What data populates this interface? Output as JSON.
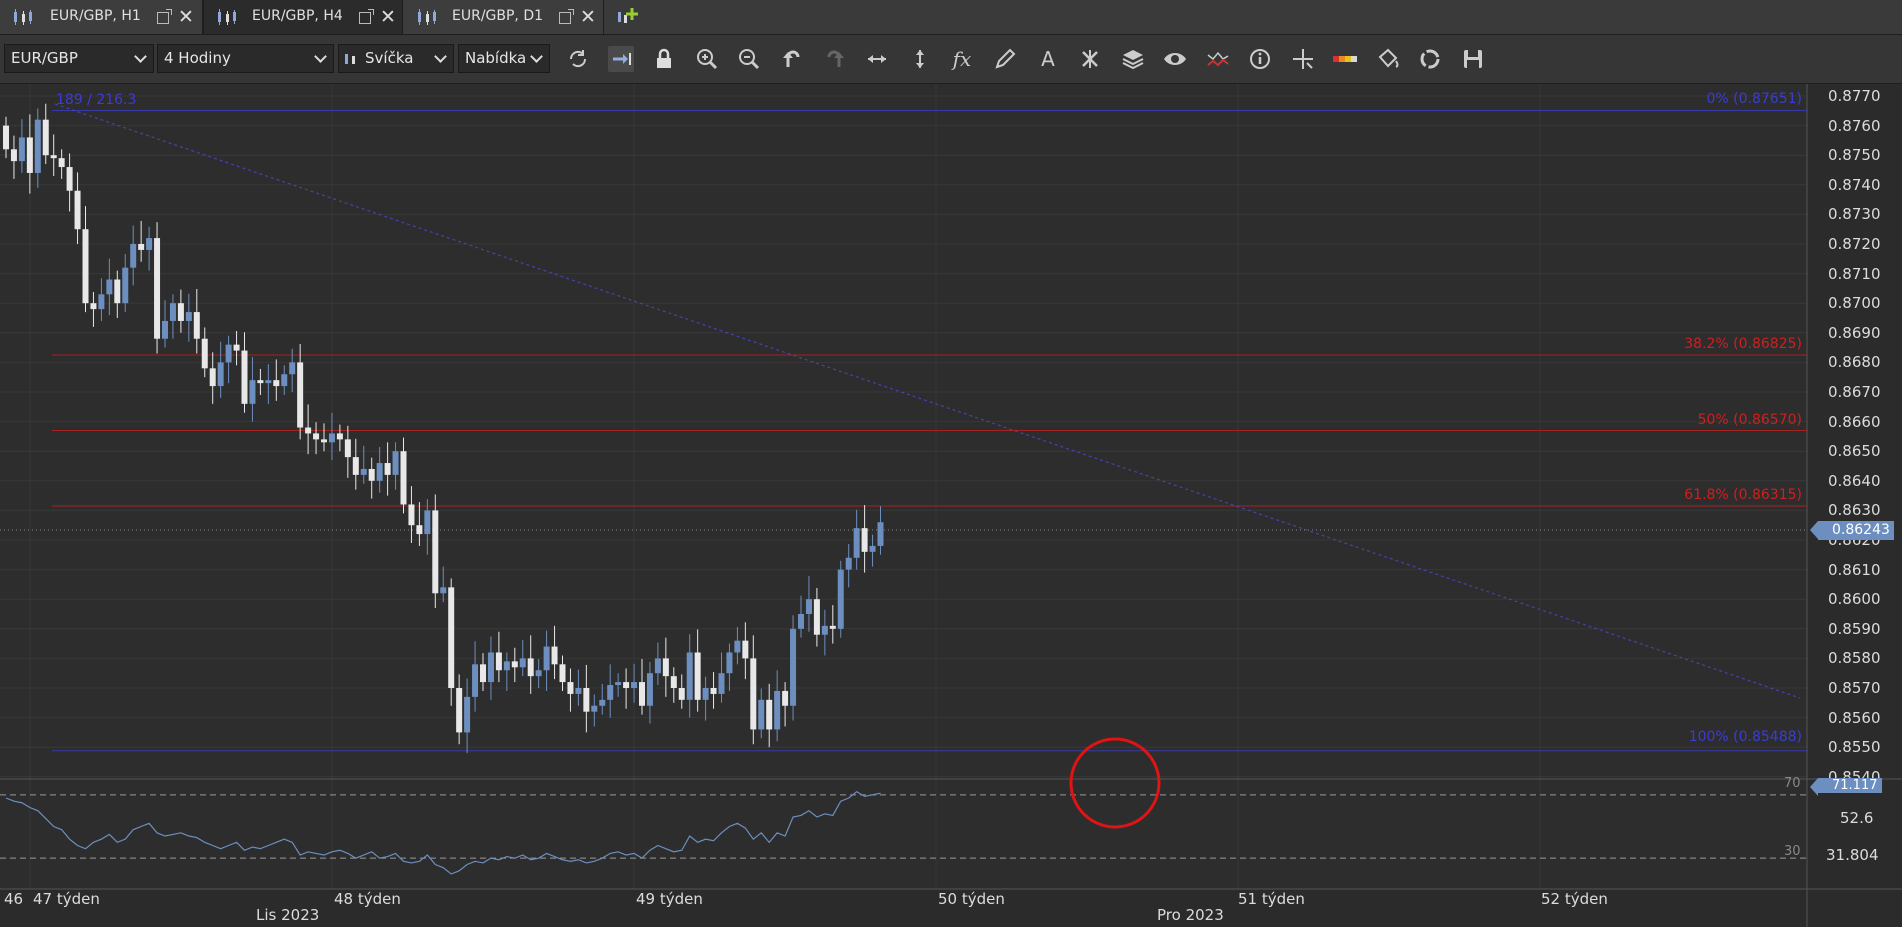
{
  "tabs": [
    {
      "label": "EUR/GBP, H1",
      "active": false
    },
    {
      "label": "EUR/GBP, H4",
      "active": true
    },
    {
      "label": "EUR/GBP, D1",
      "active": false
    }
  ],
  "add_tab_icon": "add-chart-icon",
  "toolbar": {
    "instrument": "EUR/GBP",
    "period": "4 Hodiny",
    "chart_type": "Svíčka",
    "offer_side": "Nabídka",
    "icons": [
      "refresh-icon",
      "shift-chart-icon",
      "lock-icon",
      "zoom-in-icon",
      "zoom-out-icon",
      "undo-icon",
      "redo-icon",
      "horizontal-scale-icon",
      "vertical-scale-icon",
      "indicators-icon",
      "pencil-icon",
      "text-icon",
      "cross-icon",
      "layers-icon",
      "eye-icon",
      "pattern-icon",
      "info-icon",
      "crosshair-icon",
      "theme-icon",
      "paint-bucket-icon",
      "recycle-icon",
      "save-icon"
    ]
  },
  "chart": {
    "top_left_label": "189 / 216.3",
    "current_price": "0.86243",
    "fib_levels": [
      {
        "label": "0% (0.87651)",
        "price": 0.87651,
        "color": "#3c3cd2"
      },
      {
        "label": "38.2% (0.86825)",
        "price": 0.86825,
        "color": "#d21e1e"
      },
      {
        "label": "50% (0.86570)",
        "price": 0.8657,
        "color": "#d21e1e"
      },
      {
        "label": "61.8% (0.86315)",
        "price": 0.86315,
        "color": "#d21e1e"
      },
      {
        "label": "100% (0.85488)",
        "price": 0.85488,
        "color": "#3c3cd2"
      }
    ],
    "y_labels": [
      "0.8770",
      "0.8760",
      "0.8750",
      "0.8740",
      "0.8730",
      "0.8720",
      "0.8710",
      "0.8700",
      "0.8690",
      "0.8680",
      "0.8670",
      "0.8660",
      "0.8650",
      "0.8640",
      "0.8630",
      "0.8620",
      "0.8610",
      "0.8600",
      "0.8590",
      "0.8580",
      "0.8570",
      "0.8560",
      "0.8550",
      "0.8540"
    ],
    "x_labels": [
      "46",
      "47 týden",
      "48 týden",
      "49 týden",
      "50 týden",
      "51 týden",
      "52 týden"
    ],
    "month_labels": [
      "Lis 2023",
      "Pro 2023"
    ],
    "bull_color": "#6d8fc0",
    "bear_color": "#e8e8e8",
    "rsi": {
      "value": "71.117",
      "level_70": "70",
      "level_30": "30",
      "y_labels": [
        "52.6",
        "31.804"
      ],
      "color": "#6d8fc0"
    }
  }
}
